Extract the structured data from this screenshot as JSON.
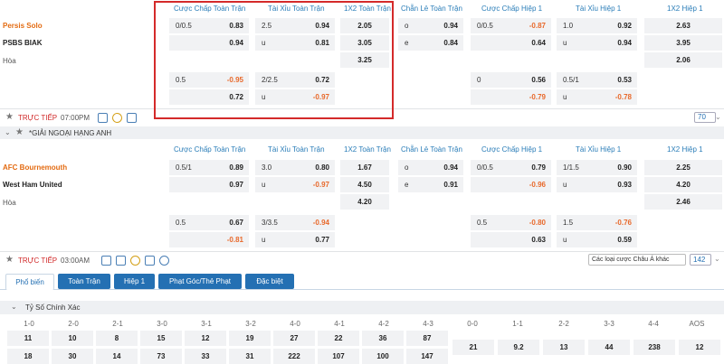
{
  "match1": {
    "home": "Persis Solo",
    "away": "PSBS BIAK",
    "draw": "Hòa",
    "headers": [
      "Cược Chấp Toàn Trận",
      "Tài Xỉu Toàn Trận",
      "1X2 Toàn Trận",
      "Chẵn Lẻ Toàn Trận",
      "Cược Chấp Hiệp 1",
      "Tài Xỉu Hiệp 1",
      "1X2 Hiệp 1"
    ],
    "ah_line1": "0/0.5",
    "ah_home1": "0.83",
    "ah_away1": "0.94",
    "ou_line1": "2.5",
    "ou_over1": "0.94",
    "ou_u": "u",
    "ou_under1": "0.81",
    "x12_home": "2.05",
    "x12_away": "3.05",
    "x12_draw": "3.25",
    "oe_o": "o",
    "oe_o_val": "0.94",
    "oe_e": "e",
    "oe_e_val": "0.84",
    "h1ah_line": "0/0.5",
    "h1ah_home": "-0.87",
    "h1ah_away": "0.64",
    "h1ou_line": "1.0",
    "h1ou_over": "0.92",
    "h1ou_u": "u",
    "h1ou_under": "0.94",
    "h1x_home": "2.63",
    "h1x_away": "3.95",
    "h1x_draw": "2.06",
    "ah_line2": "0.5",
    "ah_home2": "-0.95",
    "ah_away2": "0.72",
    "ou_line2": "2/2.5",
    "ou_over2": "0.72",
    "ou_u2": "u",
    "ou_under2": "-0.97",
    "h1ah_line2": "0",
    "h1ah_home2": "0.56",
    "h1ah_away2": "-0.79",
    "h1ou_line2": "0.5/1",
    "h1ou_over2": "0.53",
    "h1ou_u2": "u",
    "h1ou_under2": "-0.78",
    "live_label": "TRỰC TIẾP",
    "time": "07:00PM",
    "more": "70"
  },
  "league": "*GIẢI NGOẠI HẠNG ANH",
  "match2": {
    "home": "AFC Bournemouth",
    "away": "West Ham United",
    "draw": "Hòa",
    "ah_line1": "0.5/1",
    "ah_home1": "0.89",
    "ah_away1": "0.97",
    "ou_line1": "3.0",
    "ou_over1": "0.80",
    "ou_u": "u",
    "ou_under1": "-0.97",
    "x12_home": "1.67",
    "x12_away": "4.50",
    "x12_draw": "4.20",
    "oe_o": "o",
    "oe_o_val": "0.94",
    "oe_e": "e",
    "oe_e_val": "0.91",
    "h1ah_line": "0/0.5",
    "h1ah_home": "0.79",
    "h1ah_away": "-0.96",
    "h1ou_line": "1/1.5",
    "h1ou_over": "0.90",
    "h1ou_u": "u",
    "h1ou_under": "0.93",
    "h1x_home": "2.25",
    "h1x_away": "4.20",
    "h1x_draw": "2.46",
    "ah_line2": "0.5",
    "ah_home2": "0.67",
    "ah_away2": "-0.81",
    "ou_line2": "3/3.5",
    "ou_over2": "-0.94",
    "ou_u2": "u",
    "ou_under2": "0.77",
    "h1ah_line2": "0.5",
    "h1ah_home2": "-0.80",
    "h1ah_away2": "0.63",
    "h1ou_line2": "1.5",
    "h1ou_over2": "-0.76",
    "h1ou_u2": "u",
    "h1ou_under2": "0.59",
    "live_label": "TRỰC TIẾP",
    "time": "03:00AM",
    "more": "142",
    "odds_type": "Các loại cược Châu Á khác"
  },
  "tabs": [
    "Phổ biến",
    "Toàn Trận",
    "Hiệp 1",
    "Phạt Góc/Thẻ Phạt",
    "Đặc biệt"
  ],
  "correct_score": {
    "title": "Tỷ Số Chính Xác",
    "headers": [
      "1-0",
      "2-0",
      "2-1",
      "3-0",
      "3-1",
      "3-2",
      "4-0",
      "4-1",
      "4-2",
      "4-3",
      "0-0",
      "1-1",
      "2-2",
      "3-3",
      "4-4",
      "AOS"
    ],
    "row1": [
      "11",
      "10",
      "8",
      "15",
      "12",
      "19",
      "27",
      "22",
      "36",
      "87"
    ],
    "row2": [
      "18",
      "30",
      "14",
      "73",
      "33",
      "31",
      "222",
      "107",
      "100",
      "147"
    ],
    "draw_row": [
      "21",
      "9.2",
      "13",
      "44",
      "238",
      "12"
    ]
  },
  "colors": {
    "accent": "#2470b3",
    "negative": "#e8692b",
    "live": "#d12a2a",
    "highlight": "#d42a2a"
  }
}
